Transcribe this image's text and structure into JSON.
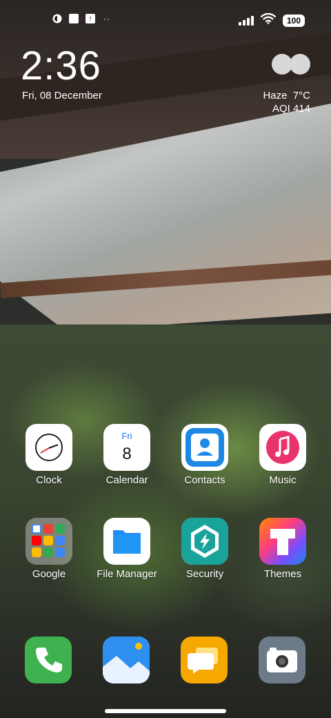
{
  "status_bar": {
    "left_icons": [
      "app-notification-icon",
      "square-notification-icon",
      "upload-icon",
      "more-notifications-icon"
    ],
    "more_dots": "··",
    "battery": "100"
  },
  "widget": {
    "time": "2:36",
    "date": "Fri, 08 December",
    "weather_condition": "Haze",
    "temperature": "7°C",
    "aqi": "AQI 414"
  },
  "apps": [
    {
      "label": "Clock",
      "icon": "clock-icon"
    },
    {
      "label": "Calendar",
      "icon": "calendar-icon",
      "day": "Fri",
      "date": "8"
    },
    {
      "label": "Contacts",
      "icon": "contacts-icon"
    },
    {
      "label": "Music",
      "icon": "music-icon"
    },
    {
      "label": "Google",
      "icon": "google-folder-icon"
    },
    {
      "label": "File Manager",
      "icon": "file-manager-icon"
    },
    {
      "label": "Security",
      "icon": "security-icon"
    },
    {
      "label": "Themes",
      "icon": "themes-icon"
    }
  ],
  "dock": [
    {
      "icon": "phone-icon",
      "color": "#3fb24f"
    },
    {
      "icon": "gallery-icon",
      "color": "#2f8ff0"
    },
    {
      "icon": "messages-icon",
      "color": "#f6a800"
    },
    {
      "icon": "camera-icon",
      "color": "#6d7a88"
    }
  ]
}
